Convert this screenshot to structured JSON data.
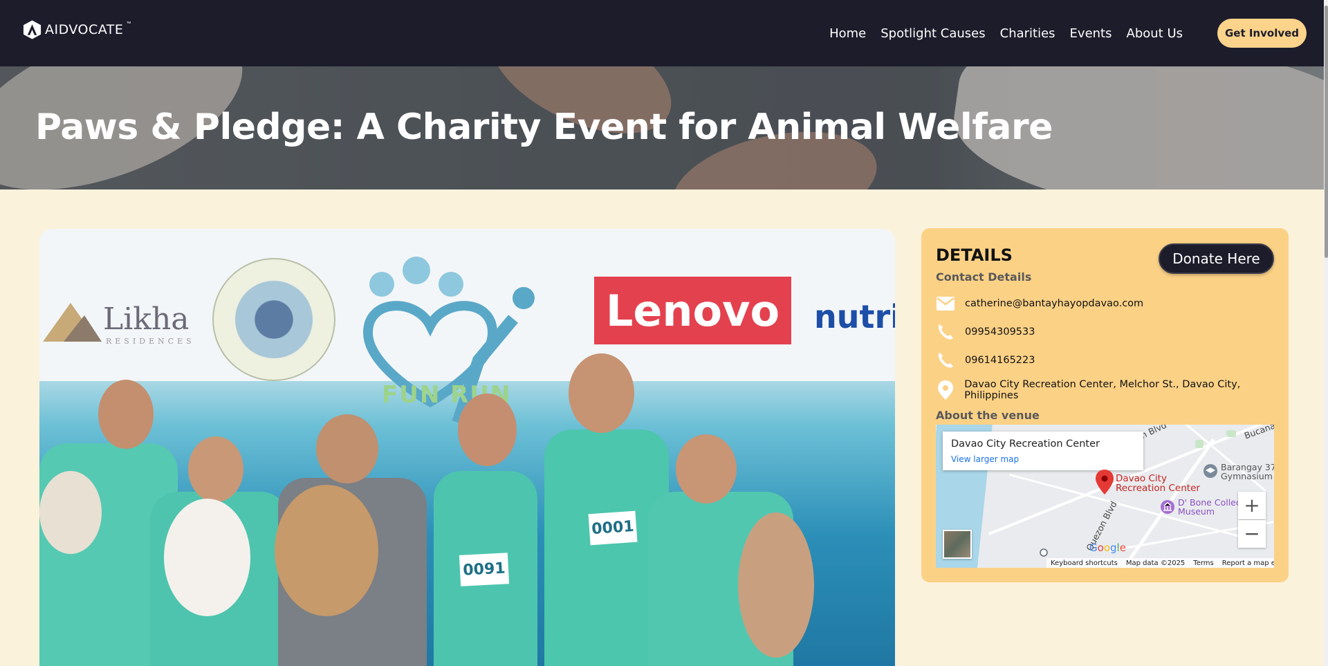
{
  "brand": {
    "name": "AIDVOCATE",
    "tm": "™",
    "logo_icon": "aidvocate-logo-icon"
  },
  "nav": {
    "items": [
      {
        "label": "Home"
      },
      {
        "label": "Spotlight Causes"
      },
      {
        "label": "Charities"
      },
      {
        "label": "Events"
      },
      {
        "label": "About Us"
      }
    ],
    "cta_label": "Get Involved"
  },
  "hero": {
    "title": "Paws & Pledge: A Charity Event for Animal Welfare"
  },
  "event_photo": {
    "banner_text": {
      "likha": "Likha",
      "likha_sub": "RESIDENCES",
      "lenovo": "Lenovo",
      "nutri": "nutri",
      "fun_run": "FUN RUN"
    },
    "bib_numbers": [
      "0091",
      "0001"
    ]
  },
  "details": {
    "title": "DETAILS",
    "donate_label": "Donate Here",
    "contact_heading": "Contact Details",
    "email": "catherine@bantayhayopdavao.com",
    "phone1": "09954309533",
    "phone2": "09614165223",
    "address": "Davao City Recreation Center, Melchor St., Davao City, Philippines",
    "venue_heading": "About the venue",
    "icons": [
      "mail-icon",
      "phone-icon",
      "phone-icon",
      "location-pin-icon"
    ],
    "accent": "#fbd186"
  },
  "map": {
    "place_name": "Davao City Recreation Center",
    "larger_map": "View larger map",
    "pin_label": "Davao City Recreation Center",
    "poi_gym": "Barangay 37 Gymnasium",
    "poi_museum": "D' Bone Collector Museum",
    "road_quezon": "Quezon Blvd",
    "road_top": "on Blvd",
    "road_bucana": "Bucana",
    "zoom_in": "+",
    "zoom_out": "−",
    "google": "Google",
    "footer": {
      "shortcuts": "Keyboard shortcuts",
      "data": "Map data ©2025",
      "terms": "Terms",
      "report": "Report a map error"
    }
  },
  "colors": {
    "nav_bg": "#1c1c2b",
    "page_bg": "#fbf2dc",
    "cta": "#fbd38a"
  }
}
